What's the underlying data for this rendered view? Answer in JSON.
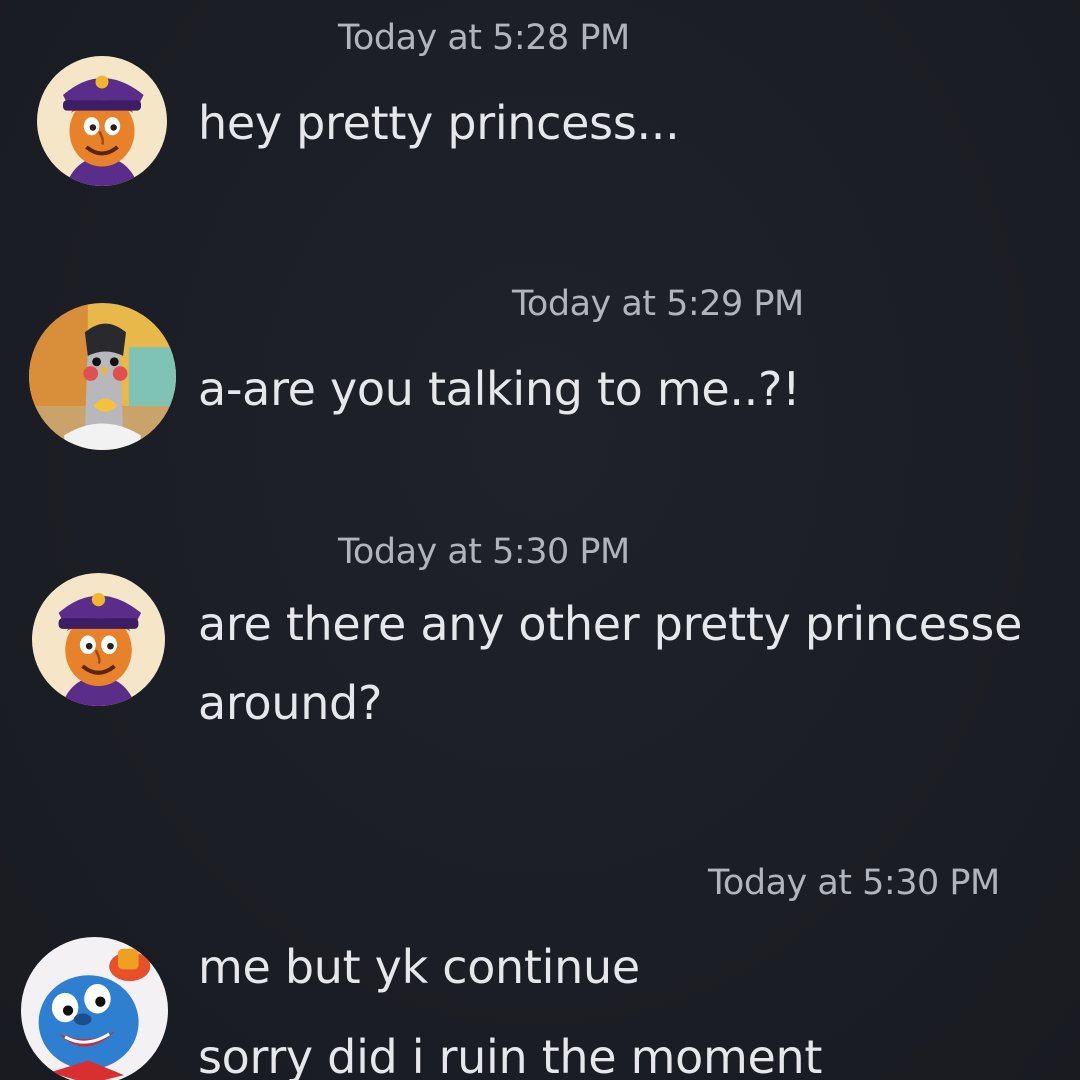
{
  "messages": [
    {
      "timestamp": "Today at 5:28 PM",
      "avatar": "purple-guard-avatar",
      "lines": [
        "hey pretty princess..."
      ]
    },
    {
      "timestamp": "Today at 5:29 PM",
      "avatar": "bird-character-avatar",
      "lines": [
        "a-are you talking to me..?!"
      ]
    },
    {
      "timestamp": "Today at 5:30 PM",
      "avatar": "purple-guard-avatar",
      "lines": [
        "are there any other pretty princesse",
        "around?"
      ]
    },
    {
      "timestamp": "Today at 5:30 PM",
      "avatar": "blue-clown-avatar",
      "lines": [
        "me but yk continue",
        "sorry did i ruin the moment"
      ]
    }
  ],
  "colors": {
    "background": "#1c1e25",
    "message_text": "#e6e7eb",
    "timestamp_text": "#b1b4bd"
  }
}
